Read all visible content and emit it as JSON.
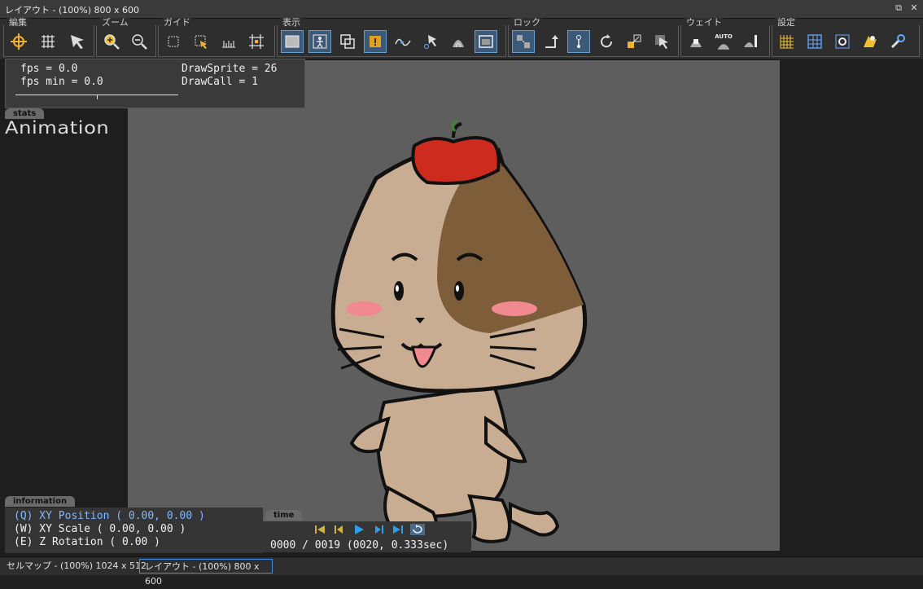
{
  "window": {
    "title": "レイアウト - (100%) 800 x 600"
  },
  "toolbar": {
    "groups": [
      {
        "label": "編集"
      },
      {
        "label": "ズーム"
      },
      {
        "label": "ガイド"
      },
      {
        "label": "表示"
      },
      {
        "label": "ロック"
      },
      {
        "label": "ウェイト"
      },
      {
        "label": "設定"
      }
    ],
    "auto_label": "AUTO"
  },
  "stats": {
    "tab": "stats",
    "fps": "fps = 0.0",
    "fps_min": "fps min = 0.0",
    "draw_sprite": "DrawSprite = 26",
    "draw_call": "DrawCall = 1"
  },
  "animation_label": "Animation",
  "information": {
    "tab": "information",
    "position": "(Q) XY Position ( 0.00, 0.00 )",
    "scale": "(W) XY Scale ( 0.00, 0.00 )",
    "rotation": "(E) Z Rotation ( 0.00 )"
  },
  "time": {
    "tab": "time",
    "readout": "0000 / 0019 (0020, 0.333sec)"
  },
  "statusbar": {
    "tabs": [
      {
        "label": "セルマップ - (100%) 1024 x 512"
      },
      {
        "label": "レイアウト - (100%) 800 x 600"
      }
    ]
  },
  "colors": {
    "accent": "#3a8ee6",
    "viewport_bg": "#5e5e5e",
    "apple": "#cc2b1e",
    "fur": "#c9ad92",
    "patch": "#7d5d3a"
  }
}
